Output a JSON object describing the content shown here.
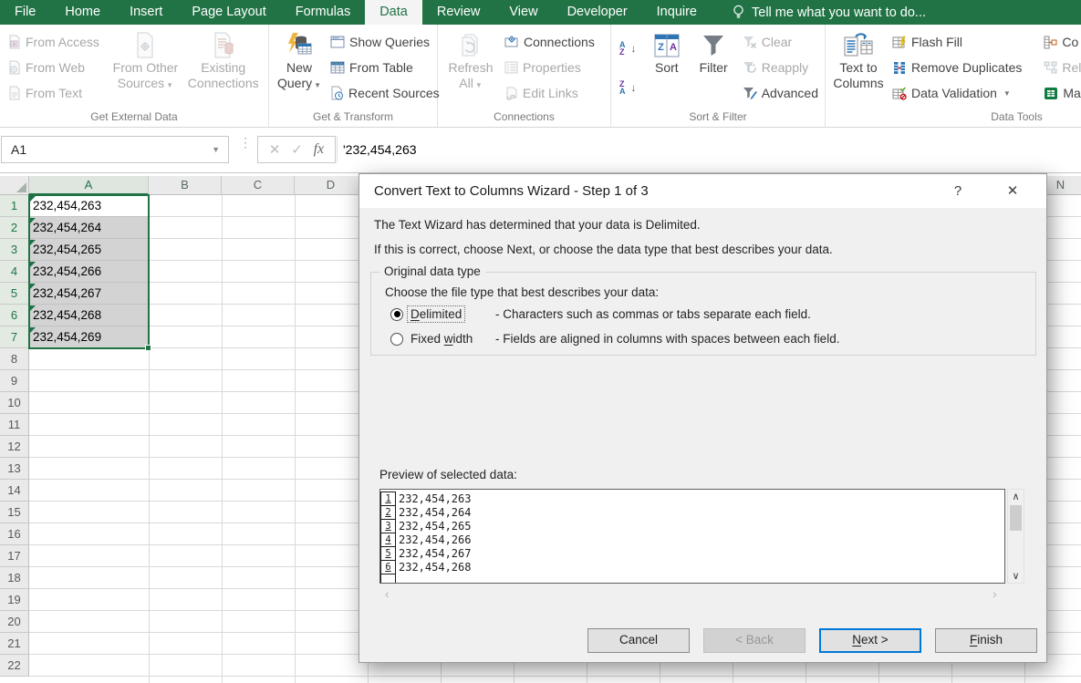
{
  "colors": {
    "accent_green": "#217346",
    "default_button_blue": "#0078D7",
    "selection_gray": "#D3D3D3"
  },
  "ribbon": {
    "tabs": [
      {
        "label": "File"
      },
      {
        "label": "Home"
      },
      {
        "label": "Insert"
      },
      {
        "label": "Page Layout"
      },
      {
        "label": "Formulas"
      },
      {
        "label": "Data",
        "cls": "active"
      },
      {
        "label": "Review"
      },
      {
        "label": "View"
      },
      {
        "label": "Developer"
      },
      {
        "label": "Inquire"
      }
    ],
    "tell_me": "Tell me what you want to do...",
    "get_external": {
      "label": "Get External Data",
      "from_access": "From Access",
      "from_web": "From Web",
      "from_text": "From Text",
      "from_other_1": "From Other",
      "from_other_2": "Sources",
      "existing_1": "Existing",
      "existing_2": "Connections"
    },
    "get_transform": {
      "label": "Get & Transform",
      "new_1": "New",
      "new_2": "Query",
      "show_queries": "Show Queries",
      "from_table": "From Table",
      "recent_sources": "Recent Sources"
    },
    "connections": {
      "label": "Connections",
      "refresh_1": "Refresh",
      "refresh_2": "All",
      "connections": "Connections",
      "properties": "Properties",
      "edit_links": "Edit Links"
    },
    "sort_filter": {
      "label": "Sort & Filter",
      "sort": "Sort",
      "filter": "Filter",
      "clear": "Clear",
      "reapply": "Reapply",
      "advanced": "Advanced"
    },
    "data_tools": {
      "label": "Data Tools",
      "t2c_1": "Text to",
      "t2c_2": "Columns",
      "flash_fill": "Flash Fill",
      "remove_duplicates": "Remove Duplicates",
      "data_validation": "Data Validation",
      "consolidate_cut": "Co",
      "relationships_cut": "Rel",
      "manage_cut": "Ma"
    }
  },
  "formula_bar": {
    "name_box": "A1",
    "formula": "'232,454,263"
  },
  "grid": {
    "col_headers": [
      {
        "label": "A",
        "cls": "colA sel"
      },
      {
        "label": "B"
      },
      {
        "label": "C"
      },
      {
        "label": "D"
      }
    ],
    "col_header_right": "N",
    "row_headers": [
      {
        "n": "1",
        "cls": "sel"
      },
      {
        "n": "2",
        "cls": "sel"
      },
      {
        "n": "3",
        "cls": "sel"
      },
      {
        "n": "4",
        "cls": "sel"
      },
      {
        "n": "5",
        "cls": "sel"
      },
      {
        "n": "6",
        "cls": "sel"
      },
      {
        "n": "7",
        "cls": "sel"
      },
      {
        "n": "8"
      },
      {
        "n": "9"
      },
      {
        "n": "10"
      },
      {
        "n": "11"
      },
      {
        "n": "12"
      },
      {
        "n": "13"
      },
      {
        "n": "14"
      },
      {
        "n": "15"
      },
      {
        "n": "16"
      },
      {
        "n": "17"
      },
      {
        "n": "18"
      },
      {
        "n": "19"
      },
      {
        "n": "20"
      },
      {
        "n": "21"
      },
      {
        "n": "22"
      }
    ],
    "cells": [
      {
        "v": "232,454,263",
        "cls": "active"
      },
      {
        "v": "232,454,264"
      },
      {
        "v": "232,454,265"
      },
      {
        "v": "232,454,266"
      },
      {
        "v": "232,454,267"
      },
      {
        "v": "232,454,268"
      },
      {
        "v": "232,454,269"
      }
    ]
  },
  "dialog": {
    "title": "Convert Text to Columns Wizard - Step 1 of 3",
    "help_glyph": "?",
    "close_glyph": "✕",
    "intro1": "The Text Wizard has determined that your data is Delimited.",
    "intro2": "If this is correct, choose Next, or choose the data type that best describes your data.",
    "group_label": "Original data type",
    "choose_label": "Choose the file type that best describes your data:",
    "radios": [
      {
        "cls": "selected",
        "pre": "",
        "key": "D",
        "post": "elimited",
        "desc": "- Characters such as commas or tabs separate each field."
      },
      {
        "pre": "Fixed ",
        "key": "w",
        "post": "idth",
        "desc": "- Fields are aligned in columns with spaces between each field."
      }
    ],
    "preview_label": "Preview of selected data:",
    "preview_rows": [
      {
        "n": "1",
        "v": "232,454,263"
      },
      {
        "n": "2",
        "v": "232,454,264"
      },
      {
        "n": "3",
        "v": "232,454,265"
      },
      {
        "n": "4",
        "v": "232,454,266"
      },
      {
        "n": "5",
        "v": "232,454,267"
      },
      {
        "n": "6",
        "v": "232,454,268"
      }
    ],
    "scroll_up_glyph": "∧",
    "scroll_down_glyph": "∨",
    "scroll_left_glyph": "‹",
    "scroll_right_glyph": "›",
    "buttons": {
      "cancel": "Cancel",
      "back": "< Back",
      "next_key": "N",
      "next_post": "ext >",
      "finish_key": "F",
      "finish_post": "inish"
    }
  }
}
